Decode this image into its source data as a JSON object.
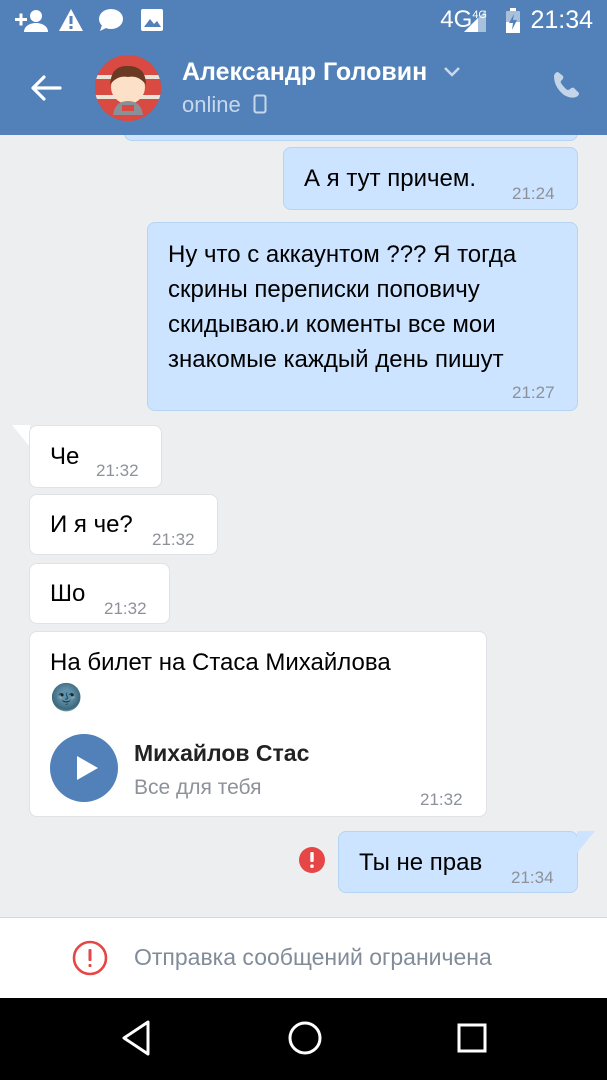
{
  "status_bar": {
    "network": "4G",
    "network_sup": "4G",
    "time": "21:34"
  },
  "header": {
    "contact_name": "Александр Головин",
    "contact_status": "online"
  },
  "messages": [
    {
      "id": "m1",
      "direction": "out",
      "text": "А я тут причем.",
      "time": "21:24"
    },
    {
      "id": "m2",
      "direction": "out",
      "text": "Ну что с аккаунтом ??? Я тогда скрины переписки поповичу скидываю.и коменты все мои знакомые каждый день пишут",
      "lines": [
        "Ну что с аккаунтом ??? Я тогда",
        "скрины переписки поповичу",
        "скидываю.и коменты все мои",
        "знакомые каждый день пишут"
      ],
      "time": "21:27"
    },
    {
      "id": "m3",
      "direction": "in",
      "text": "Че",
      "time": "21:32"
    },
    {
      "id": "m4",
      "direction": "in",
      "text": "И я че?",
      "time": "21:32"
    },
    {
      "id": "m5",
      "direction": "in",
      "text": "Шо",
      "time": "21:32"
    },
    {
      "id": "m6",
      "direction": "in",
      "text": "На билет на Стаса Михайлова",
      "emoji": "🌚",
      "time": "21:32",
      "attachment": {
        "type": "audio",
        "title": "Михайлов Стас",
        "subtitle": "Все для тебя"
      }
    },
    {
      "id": "m7",
      "direction": "out",
      "text": "Ты не прав",
      "time": "21:34",
      "failed": true
    }
  ],
  "restriction_text": "Отправка сообщений ограничена",
  "colors": {
    "brand": "#5181b8",
    "outgoing_bubble": "#cce4ff",
    "error": "#e64646"
  },
  "icons": [
    "add-friend-icon",
    "warning-icon",
    "chat-icon",
    "image-icon",
    "battery-icon",
    "back-arrow-icon",
    "chevron-down-icon",
    "mobile-icon",
    "phone-icon",
    "play-icon",
    "error-icon",
    "nav-back-icon",
    "nav-home-icon",
    "nav-recents-icon"
  ]
}
